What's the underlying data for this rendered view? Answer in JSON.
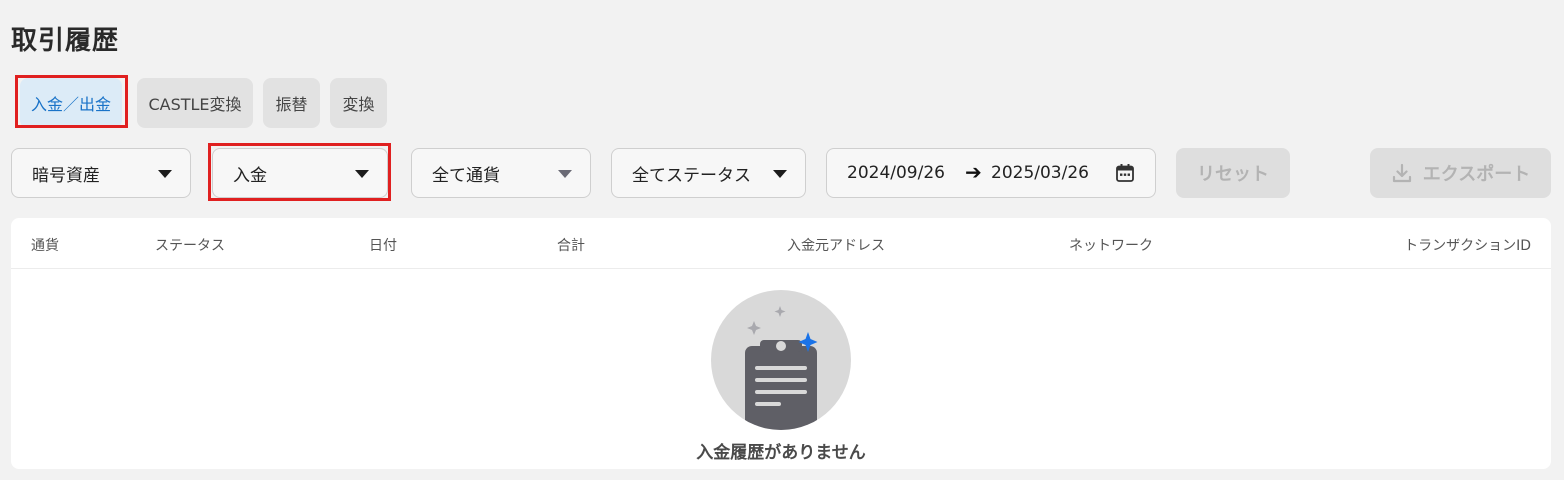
{
  "page": {
    "title": "取引履歴"
  },
  "tabs": [
    {
      "label": "入金／出金",
      "active": true
    },
    {
      "label": "CASTLE変換",
      "active": false
    },
    {
      "label": "振替",
      "active": false
    },
    {
      "label": "変換",
      "active": false
    }
  ],
  "filters": {
    "asset_type": "暗号資産",
    "direction": "入金",
    "currency": "全て通貨",
    "status": "全てステータス",
    "date_from": "2024/09/26",
    "date_arrow": "➔",
    "date_to": "2025/03/26",
    "reset_label": "リセット",
    "export_label": "エクスポート"
  },
  "table": {
    "columns": [
      "通貨",
      "ステータス",
      "日付",
      "合計",
      "入金元アドレス",
      "ネットワーク",
      "トランザクションID"
    ],
    "rows": [],
    "empty_message": "入金履歴がありません"
  },
  "colors": {
    "accent": "#1a73c8",
    "highlight": "#e02020",
    "sparkle": "#1a73e8"
  },
  "icons": {
    "select_caret": "caret-down-icon",
    "calendar": "calendar-icon",
    "export": "download-icon",
    "empty_state": "clipboard-icon"
  }
}
